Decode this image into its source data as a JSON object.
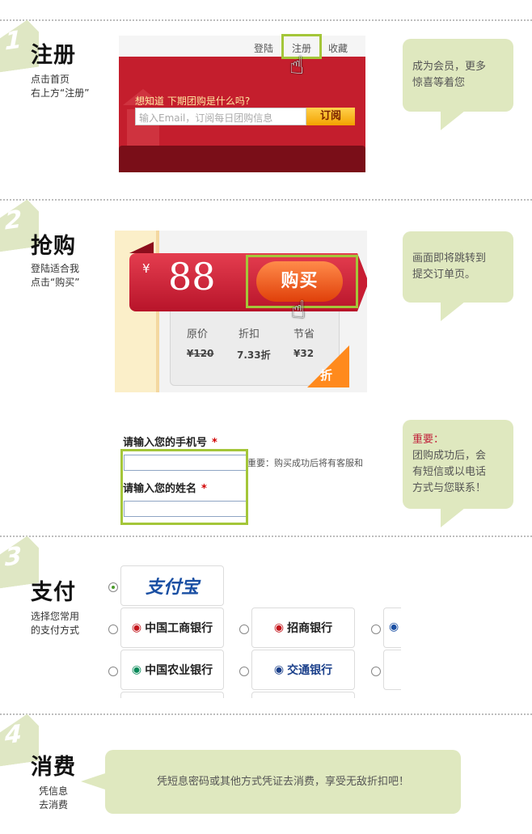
{
  "step1": {
    "num": "1",
    "title": "注册",
    "desc": [
      "点击首页",
      "右上方“注册”"
    ],
    "topbar": {
      "login": "登陆",
      "register": "注册",
      "favorite": "收藏"
    },
    "prompt": "想知道 下期团购是什么吗?",
    "email_placeholder": "输入Email，订阅每日团购信息",
    "subscribe_label": "订阅",
    "bubble": [
      "成为会员，更多",
      "惊喜等着您"
    ]
  },
  "step2": {
    "num": "2",
    "title": "抢购",
    "desc": [
      "登陆适合我",
      "点击“购买”"
    ],
    "currency": "¥",
    "price": "88",
    "buy_label": "购买",
    "col_labels": [
      "原价",
      "折扣",
      "节省"
    ],
    "col_values": [
      "¥120",
      "7.33折",
      "¥32"
    ],
    "discount_badge": "折",
    "bubble": [
      "画面即将跳转到",
      "提交订单页。"
    ]
  },
  "order_form": {
    "phone_label": "请输入您的手机号",
    "name_label": "请输入您的姓名",
    "required_mark": "*",
    "note": "重要：购买成功后将有客服和",
    "bubble_title": "重要：",
    "bubble": [
      "团购成功后，会",
      "有短信或以电话",
      "方式与您联系！"
    ]
  },
  "step3": {
    "num": "3",
    "title": "支付",
    "desc": [
      "选择您常用",
      "的支付方式"
    ],
    "alipay": "支付宝",
    "banks": [
      "中国工商银行",
      "招商银行",
      "中国农业银行",
      "交通银行"
    ]
  },
  "step4": {
    "num": "4",
    "title": "消费",
    "desc": [
      "凭信息",
      "去消费"
    ],
    "bubble": "凭短息密码或其他方式凭证去消费，享受无敌折扣吧！"
  },
  "colors": {
    "highlight": "#a4c639",
    "bubble": "#dfe8bf",
    "brand_red": "#c41e2d",
    "buy_orange": "#e0400a"
  }
}
